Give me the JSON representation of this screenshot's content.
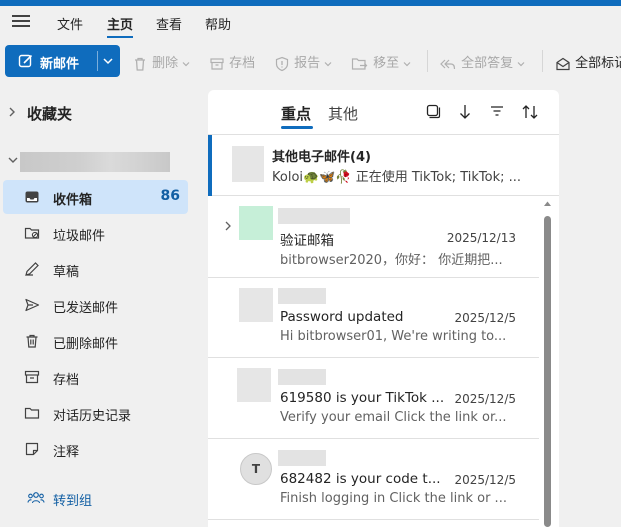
{
  "menu": {
    "tabs": [
      "文件",
      "主页",
      "查看",
      "帮助"
    ],
    "active": "主页"
  },
  "ribbon": {
    "new_mail": "新邮件",
    "delete": "删除",
    "archive": "存档",
    "report": "报告",
    "move_to": "移至",
    "reply_all": "全部答复",
    "mark_all": "全部标记"
  },
  "sidebar": {
    "favorites": "收藏夹",
    "folders": [
      {
        "label": "收件箱",
        "count": "86",
        "icon": "inbox-icon"
      },
      {
        "label": "垃圾邮件",
        "count": "",
        "icon": "junk-icon"
      },
      {
        "label": "草稿",
        "count": "",
        "icon": "draft-icon"
      },
      {
        "label": "已发送邮件",
        "count": "",
        "icon": "sent-icon"
      },
      {
        "label": "已删除邮件",
        "count": "",
        "icon": "trash-icon"
      },
      {
        "label": "存档",
        "count": "",
        "icon": "archive-icon"
      },
      {
        "label": "对话历史记录",
        "count": "",
        "icon": "folder-icon"
      },
      {
        "label": "注释",
        "count": "",
        "icon": "note-icon"
      }
    ],
    "goto_groups": "转到组"
  },
  "list": {
    "tab_focused": "重点",
    "tab_other": "其他",
    "group": {
      "title": "其他电子邮件(4)",
      "preview": "Koloi🐢🦋🥀 正在使用 TikTok; TikTok; ..."
    },
    "messages": [
      {
        "subject": "验证邮箱",
        "date": "2025/12/13",
        "preview": "bitbrowser2020，你好：  你近期把..."
      },
      {
        "subject": "Password updated",
        "date": "2025/12/5",
        "preview": "Hi bitbrowser01, We're writing to..."
      },
      {
        "subject": "619580 is your TikTok ...",
        "date": "2025/12/5",
        "preview": "Verify your email Click the link or..."
      },
      {
        "subject": "682482 is your code t...",
        "date": "2025/12/5",
        "preview": "Finish logging in Click the link or ...",
        "avatar_letter": "T"
      }
    ]
  },
  "colors": {
    "accent": "#0f6cbd",
    "selected_bg": "#cfe4fa",
    "app_bg": "#f0f0f0"
  }
}
